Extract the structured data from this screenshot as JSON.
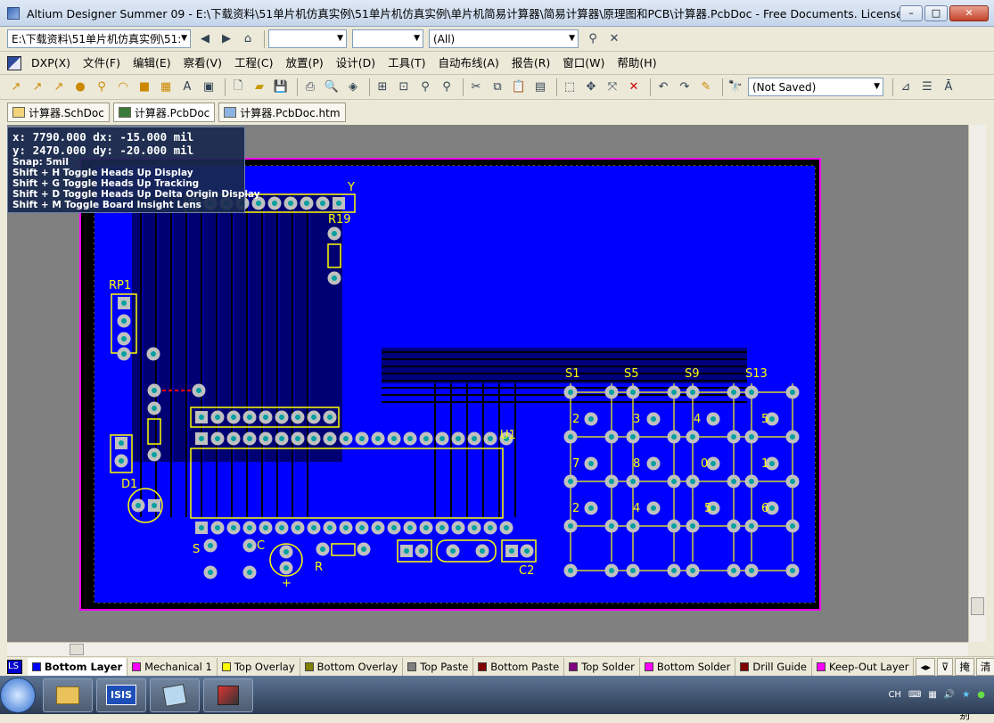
{
  "window": {
    "title": "Altium Designer Summer 09 - E:\\下载资料\\51单片机仿真实例\\51单片机仿真实例\\单片机简易计算器\\简易计算器\\原理图和PCB\\计算器.PcbDoc - Free Documents. Licensed to ..."
  },
  "address": {
    "path": "E:\\下载资料\\51单片机仿真实例\\51:",
    "combo2": "",
    "combo3": "",
    "filter": "(All)"
  },
  "menu": [
    "DXP(X)",
    "文件(F)",
    "编辑(E)",
    "察看(V)",
    "工程(C)",
    "放置(P)",
    "设计(D)",
    "工具(T)",
    "自动布线(A)",
    "报告(R)",
    "窗口(W)",
    "帮助(H)"
  ],
  "toolbar": {
    "saved_state": "(Not Saved)"
  },
  "tabs": [
    {
      "label": "计算器.SchDoc"
    },
    {
      "label": "计算器.PcbDoc"
    },
    {
      "label": "计算器.PcbDoc.htm"
    }
  ],
  "hud": {
    "x_line": "x:  7790.000   dx:   -15.000  mil",
    "y_line": "y:  2470.000   dy:   -20.000  mil",
    "snap": "Snap: 5mil",
    "shortcuts": [
      "Shift + H   Toggle Heads Up Display",
      "Shift + G   Toggle Heads Up Tracking",
      "Shift + D   Toggle Heads Up Delta Origin Display",
      "Shift + M  Toggle Board Insight Lens"
    ]
  },
  "board": {
    "labels": [
      "R19",
      "RP1",
      "D1",
      "U1",
      "S1",
      "S5",
      "S9",
      "S13",
      "C2",
      "Y",
      "S",
      "C",
      "R",
      "+"
    ],
    "key_labels": [
      "2",
      "3",
      "4",
      "5",
      "7",
      "8",
      "0",
      "1",
      "2",
      "4",
      "5",
      "6"
    ]
  },
  "layers": {
    "ls": "LS",
    "items": [
      {
        "label": "Bottom Layer",
        "color": "#0000ff"
      },
      {
        "label": "Mechanical 1",
        "color": "#ff00ff"
      },
      {
        "label": "Top Overlay",
        "color": "#ffff00"
      },
      {
        "label": "Bottom Overlay",
        "color": "#808000"
      },
      {
        "label": "Top Paste",
        "color": "#808080"
      },
      {
        "label": "Bottom Paste",
        "color": "#800000"
      },
      {
        "label": "Top Solder",
        "color": "#800080"
      },
      {
        "label": "Bottom Solder",
        "color": "#ff00ff"
      },
      {
        "label": "Drill Guide",
        "color": "#800000"
      },
      {
        "label": "Keep-Out Layer",
        "color": "#ff00ff"
      }
    ],
    "mask_level": "掩膜级别",
    "clear": "清除"
  },
  "taskbar": {
    "apps": [
      "",
      "",
      "ISIS",
      "",
      ""
    ],
    "tray": "CH"
  }
}
